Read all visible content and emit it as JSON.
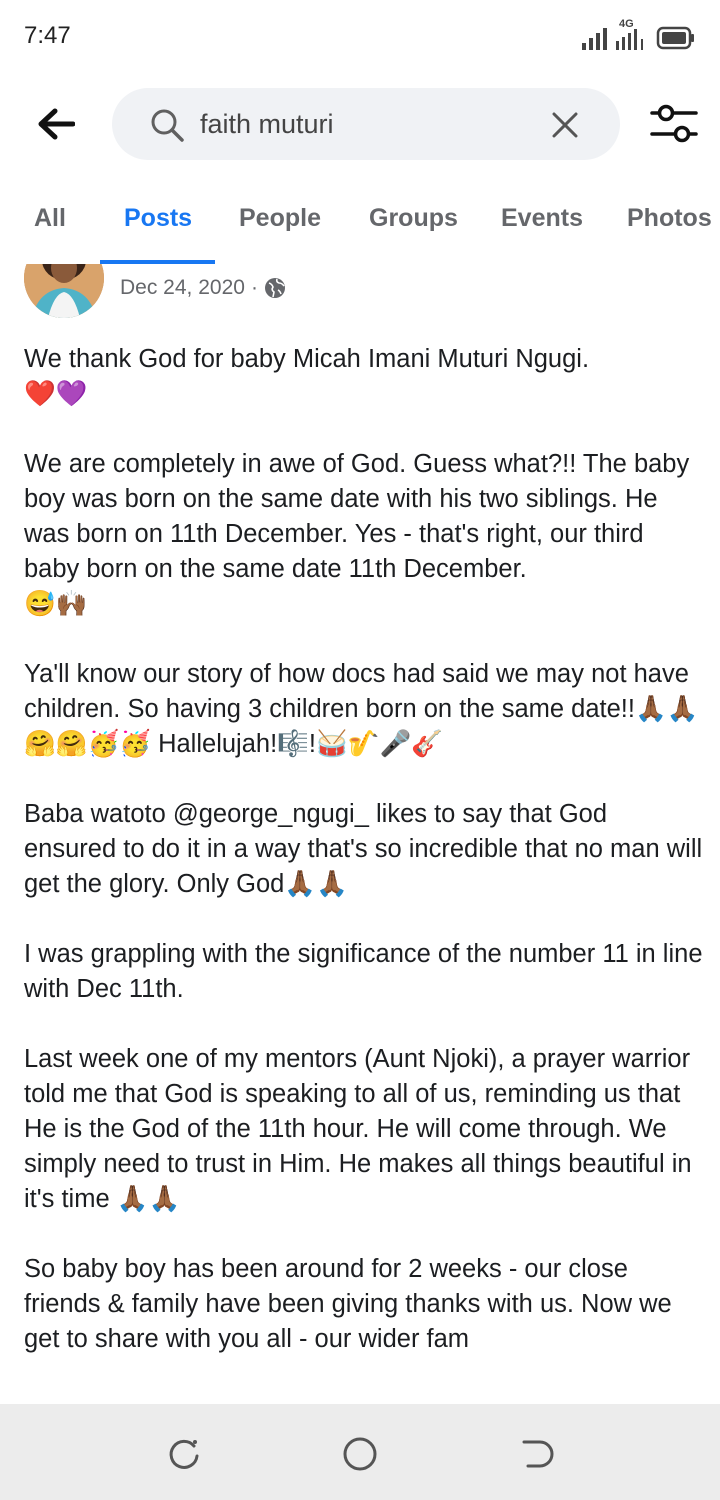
{
  "status_bar": {
    "time": "7:47",
    "network_label": "4G",
    "icons": [
      "signal-icon",
      "signal-4g-icon",
      "battery-icon"
    ]
  },
  "search": {
    "query": "faith muturi",
    "icons": [
      "back-arrow-icon",
      "search-icon",
      "close-icon",
      "filter-icon"
    ]
  },
  "tabs": [
    {
      "label": "All",
      "active": false
    },
    {
      "label": "Posts",
      "active": true
    },
    {
      "label": "People",
      "active": false
    },
    {
      "label": "Groups",
      "active": false
    },
    {
      "label": "Events",
      "active": false
    },
    {
      "label": "Photos",
      "active": false
    }
  ],
  "post": {
    "date": "Dec 24, 2020",
    "separator": "·",
    "privacy_icon": "globe-icon",
    "paragraphs": [
      "We thank God for baby Micah Imani Muturi Ngugi.\n❤️💜",
      "We are completely in awe of God. Guess what?!! The baby boy was born on the same date with his two siblings. He was born on 11th December. Yes - that's right, our third baby born on the same date 11th December.\n😅🙌🏾",
      "Ya'll know our story of how docs had said we may not have children. So having 3 children born on the same date!!🙏🏾🙏🏾🤗🤗🥳🥳 Hallelujah!🎼!🥁🎷🎤🎸",
      "Baba watoto @george_ngugi_ likes to  say that God ensured to do it in a way that's so incredible that no man will get the glory. Only God🙏🏾🙏🏾",
      "I was grappling with the significance of the number 11 in line with Dec 11th.",
      "Last week one of my mentors (Aunt Njoki), a prayer warrior told me that God is speaking to all of us, reminding us that He is the God of the 11th hour. He will come through. We simply need to trust in Him. He makes all things beautiful in it's time 🙏🏾🙏🏾",
      "So baby boy has been around for 2 weeks - our close friends & family have been giving thanks with us. Now we get to share with you all - our wider fam"
    ]
  },
  "colors": {
    "accent": "#1877f2",
    "search_bg": "#f0f2f5",
    "nav_bg": "#ececec",
    "muted_text": "#65676b"
  },
  "nav_bar": {
    "icons": [
      "recent-apps-icon",
      "home-icon",
      "back-icon"
    ]
  }
}
